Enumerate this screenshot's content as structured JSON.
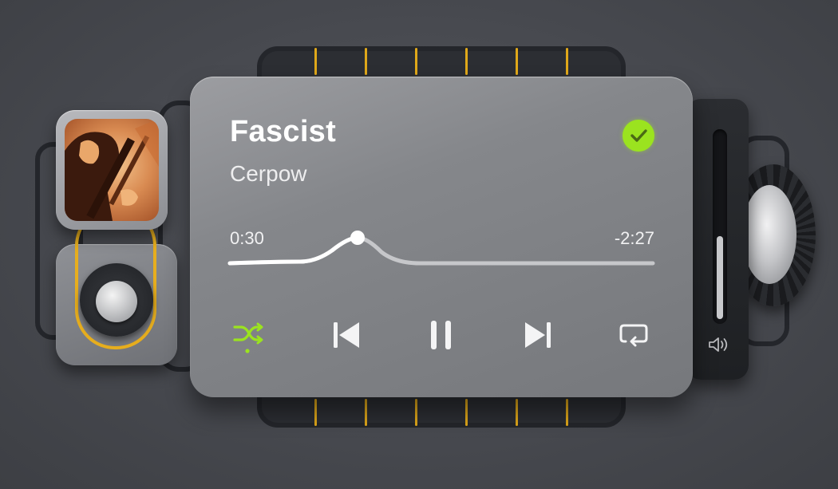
{
  "track": {
    "title": "Fascist",
    "artist": "Cerpow",
    "liked": true
  },
  "progress": {
    "elapsed": "0:30",
    "remaining": "-2:27"
  },
  "controls": {
    "shuffle_icon": "shuffle-icon",
    "previous_icon": "skip-back-icon",
    "play_pause_icon": "pause-icon",
    "next_icon": "skip-forward-icon",
    "repeat_icon": "repeat-icon"
  },
  "volume": {
    "level": 0.45,
    "icon": "speaker-icon"
  },
  "colors": {
    "accent": "#9be31f",
    "belt": "#e7ae1e",
    "card_text": "#ffffff"
  }
}
